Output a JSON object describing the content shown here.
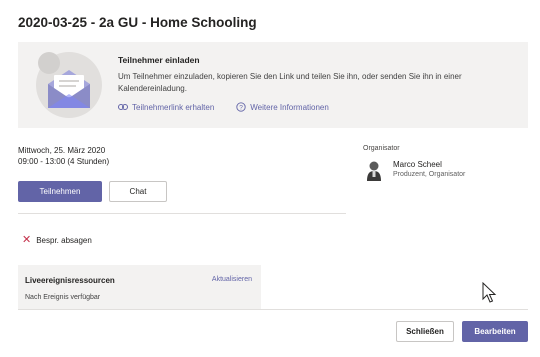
{
  "meeting": {
    "title": "2020-03-25 - 2a GU - Home Schooling",
    "date": "Mittwoch, 25. März 2020",
    "time": "09:00 - 13:00 (4 Stunden)"
  },
  "invite": {
    "heading": "Teilnehmer einladen",
    "description": "Um Teilnehmer einzuladen, kopieren Sie den Link und teilen Sie ihn, oder senden Sie ihn in einer Kalendereinladung.",
    "link_label": "Teilnehmerlink erhalten",
    "info_label": "Weitere Informationen"
  },
  "actions": {
    "join_label": "Teilnehmen",
    "chat_label": "Chat",
    "decline_label": "Bespr. absagen"
  },
  "live_event": {
    "title": "Liveereignisressourcen",
    "update_label": "Aktualisieren",
    "status": "Nach Ereignis verfügbar"
  },
  "organizer": {
    "label": "Organisator",
    "name": "Marco Scheel",
    "role": "Produzent, Organisator"
  },
  "footer": {
    "close_label": "Schließen",
    "edit_label": "Bearbeiten"
  },
  "colors": {
    "accent": "#6264a7",
    "panel": "#f3f2f1",
    "decline": "#c4314b"
  }
}
